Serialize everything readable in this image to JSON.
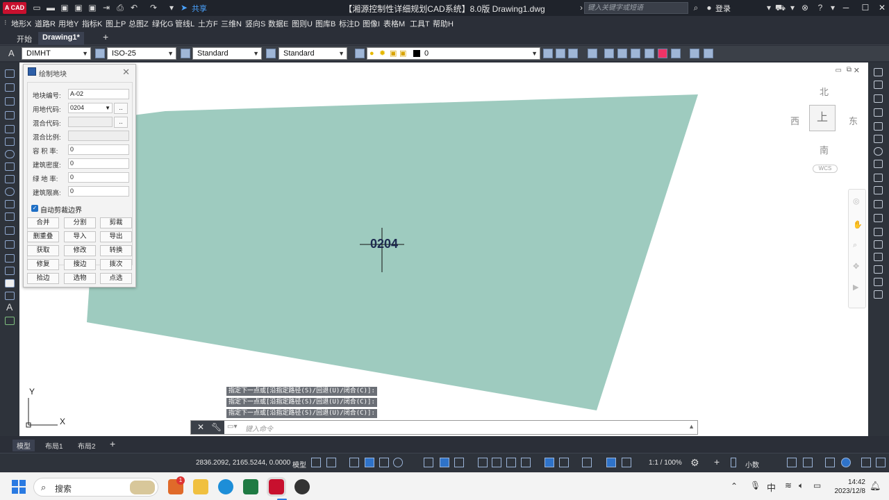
{
  "titlebar": {
    "logo": "A CAD",
    "title": "【湘源控制性详细规划CAD系统】8.0版   Drawing1.dwg",
    "share": "共享",
    "search_placeholder": "键入关键字或短语",
    "login": "登录"
  },
  "menu": [
    "地形X",
    "道路R",
    "用地Y",
    "指标K",
    "图上P",
    "总图Z",
    "绿化G",
    "管线L",
    "土方F",
    "三维N",
    "竖向S",
    "数据E",
    "图则U",
    "图库B",
    "标注D",
    "图像I",
    "表格M",
    "工具T",
    "帮助H"
  ],
  "tabs": {
    "start": "开始",
    "drawing": "Drawing1*",
    "add": "+"
  },
  "toolbar": {
    "dimstyle": "DIMHT",
    "dimscale": "ISO-25",
    "textstyle": "Standard",
    "tablestyle": "Standard",
    "layer": "0"
  },
  "dialog": {
    "title": "绘制地块",
    "fields": [
      {
        "label": "地块编号:",
        "value": "A-02"
      },
      {
        "label": "用地代码:",
        "value": "0204"
      },
      {
        "label": "混合代码:",
        "value": ""
      },
      {
        "label": "混合比例:",
        "value": ""
      },
      {
        "label": "容 积 率:",
        "value": "0"
      },
      {
        "label": "建筑密度:",
        "value": "0"
      },
      {
        "label": "绿 地 率:",
        "value": "0"
      },
      {
        "label": "建筑限高:",
        "value": "0"
      }
    ],
    "browse": "..",
    "checkbox_label": "自动剪裁边界",
    "checkbox_checked": true,
    "buttons": [
      "合并",
      "分割",
      "剪裁",
      "删重叠",
      "导入",
      "导出",
      "获取",
      "修改",
      "转换",
      "修复",
      "搜边",
      "拨次",
      "拾边",
      "选物",
      "点选"
    ]
  },
  "canvas": {
    "plot_label": "0204",
    "fill_color": "#9ecbbf",
    "compass": {
      "north": "北",
      "south": "南",
      "east": "东",
      "west": "西",
      "top": "上",
      "wcs": "WCS"
    },
    "ucs": {
      "x": "X",
      "y": "Y"
    }
  },
  "command": {
    "history": [
      "指定下一点或[沿指定路径(S)/回退(U)/闭合(C)]:",
      "指定下一点或[沿指定路径(S)/回退(U)/闭合(C)]:",
      "指定下一点或[沿指定路径(S)/回退(U)/闭合(C)]:"
    ],
    "placeholder": "键入命令"
  },
  "layouts": [
    "模型",
    "布局1",
    "布局2",
    "+"
  ],
  "status": {
    "coords": "2836.2092, 2165.5244, 0.0000",
    "mode": "模型",
    "scale": "1:1 / 100%",
    "units": "小数"
  },
  "taskbar": {
    "search": "搜索",
    "ime": "中",
    "time": "14:42",
    "date": "2023/12/8",
    "badge": "1"
  }
}
